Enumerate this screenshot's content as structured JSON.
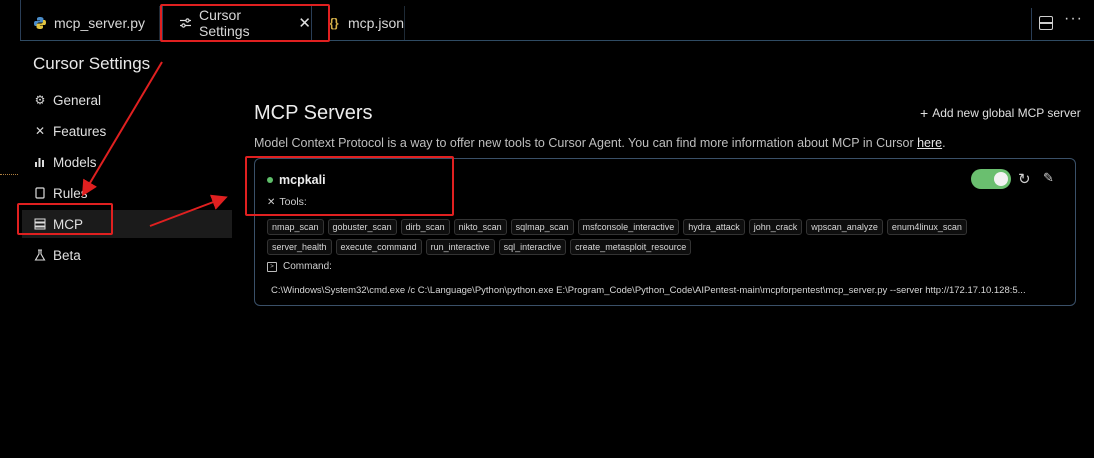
{
  "tabs": [
    {
      "label": "mcp_server.py",
      "icon": "python-file-icon"
    },
    {
      "label": "Cursor Settings",
      "icon": "settings-sliders-icon",
      "active": true
    },
    {
      "label": "mcp.json",
      "icon": "json-braces-icon"
    }
  ],
  "sidebar": {
    "title": "Cursor Settings",
    "items": [
      {
        "label": "General",
        "icon": "gear-icon"
      },
      {
        "label": "Features",
        "icon": "tools-icon"
      },
      {
        "label": "Models",
        "icon": "bar-chart-icon"
      },
      {
        "label": "Rules",
        "icon": "document-icon"
      },
      {
        "label": "MCP",
        "icon": "server-icon",
        "active": true
      },
      {
        "label": "Beta",
        "icon": "flask-icon"
      }
    ]
  },
  "main": {
    "title": "MCP Servers",
    "add_button": "Add new global MCP server",
    "description": "Model Context Protocol is a way to offer new tools to Cursor Agent. You can find more information about MCP in Cursor ",
    "description_link": "here",
    "description_end": "."
  },
  "server": {
    "name": "mcpkali",
    "status_color": "#5fbf6a",
    "enabled": true,
    "tools_label": "Tools:",
    "tools": [
      "nmap_scan",
      "gobuster_scan",
      "dirb_scan",
      "nikto_scan",
      "sqlmap_scan",
      "msfconsole_interactive",
      "hydra_attack",
      "john_crack",
      "wpscan_analyze",
      "enum4linux_scan",
      "server_health",
      "execute_command",
      "run_interactive",
      "sql_interactive",
      "create_metasploit_resource"
    ],
    "command_label": "Command:",
    "command": "C:\\Windows\\System32\\cmd.exe /c C:\\Language\\Python\\python.exe E:\\Program_Code\\Python_Code\\AIPentest-main\\mcpforpentest\\mcp_server.py --server http://172.17.10.128:5..."
  },
  "colors": {
    "accent_green": "#6abf6f",
    "annotation_red": "#e02020",
    "card_border": "#3a5068"
  }
}
